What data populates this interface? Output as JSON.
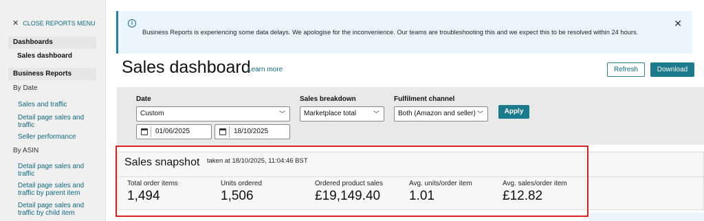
{
  "sidebar": {
    "close_label": "CLOSE REPORTS MENU",
    "dashboards_header": "Dashboards",
    "active_item": "Sales dashboard",
    "business_reports_header": "Business Reports",
    "by_date_label": "By Date",
    "by_date_items": [
      "Sales and traffic",
      "Detail page sales and traffic",
      "Seller performance"
    ],
    "by_asin_label": "By ASIN",
    "by_asin_items": [
      "Detail page sales and traffic",
      "Detail page sales and traffic by parent item",
      "Detail page sales and traffic by child item"
    ]
  },
  "banner": {
    "message": "Business Reports is experiencing some data delays. We apologise for the inconvenience. Our teams are troubleshooting this and we expect this to be resolved within 24 hours."
  },
  "header": {
    "title": "Sales dashboard",
    "learn_more": "Learn more",
    "refresh_label": "Refresh",
    "download_label": "Download"
  },
  "filters": {
    "date_label": "Date",
    "date_value": "Custom",
    "start_date": "01/06/2025",
    "end_date": "18/10/2025",
    "breakdown_label": "Sales breakdown",
    "breakdown_value": "Marketplace total",
    "channel_label": "Fulfilment channel",
    "channel_value": "Both (Amazon and seller)",
    "apply_label": "Apply"
  },
  "snapshot": {
    "title": "Sales snapshot",
    "taken_at": "taken at 18/10/2025, 11:04:46 BST",
    "metrics": [
      {
        "label": "Total order items",
        "value": "1,494"
      },
      {
        "label": "Units ordered",
        "value": "1,506"
      },
      {
        "label": "Ordered product sales",
        "value": "£19,149.40"
      },
      {
        "label": "Avg. units/order item",
        "value": "1.01"
      },
      {
        "label": "Avg. sales/order item",
        "value": "£12.82"
      }
    ]
  },
  "colors": {
    "accent": "#1b7a8c",
    "link": "#0f6a82",
    "banner_bg": "#eaf6fb",
    "highlight": "#d81f1f"
  },
  "icons": [
    "close-icon",
    "info-icon",
    "chevron-down-icon",
    "calendar-icon"
  ]
}
